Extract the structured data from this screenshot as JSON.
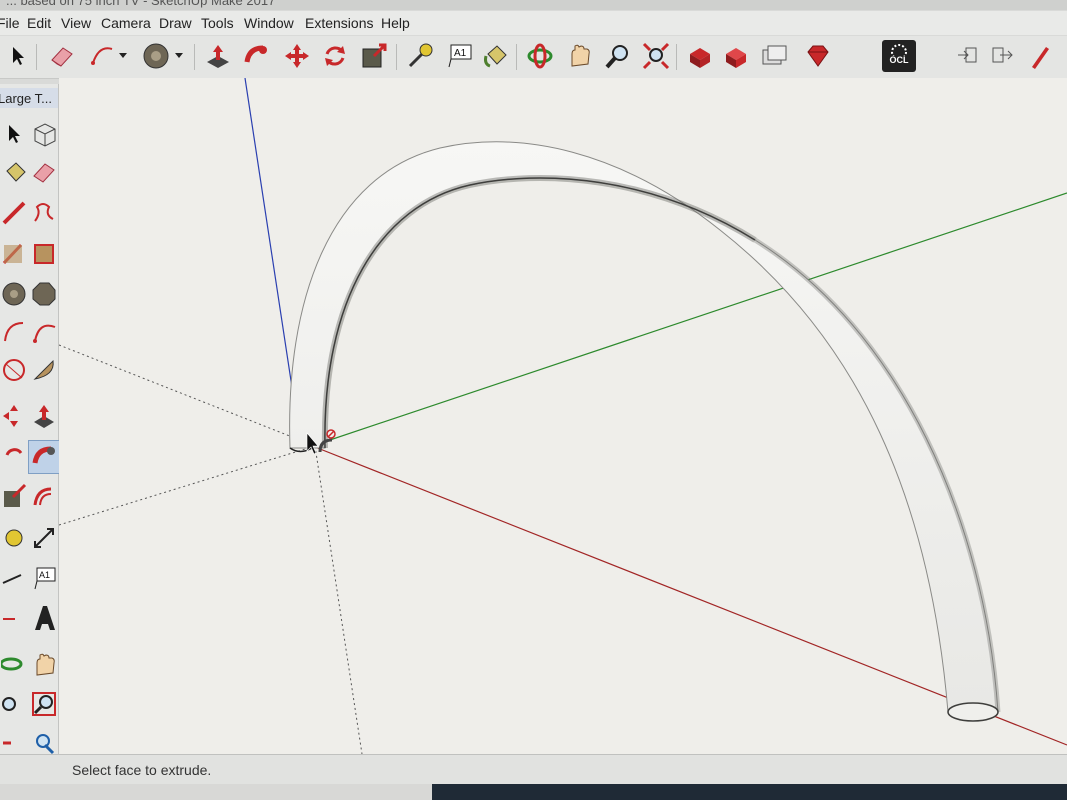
{
  "window": {
    "title": "... based on 75 inch TV - SketchUp Make 2017"
  },
  "menubar": {
    "items": [
      "File",
      "Edit",
      "View",
      "Camera",
      "Draw",
      "Tools",
      "Window",
      "Extensions",
      "Help"
    ]
  },
  "toolbar": {
    "tools": [
      "select-icon",
      "eraser-icon",
      "arc-icon",
      "dropdown-icon",
      "circle-icon",
      "dropdown-icon",
      "push-pull-icon",
      "follow-me-icon",
      "move-icon",
      "rotate-icon",
      "scale-icon",
      "tape-measure-icon",
      "text-icon",
      "paint-bucket-icon",
      "orbit-icon",
      "pan-icon",
      "zoom-icon",
      "zoom-extents-icon",
      "warehouse-icon",
      "extension-warehouse-icon",
      "layout-icon",
      "ruby-icon"
    ],
    "text_tool_label": "A1",
    "ocl_label": "OCL",
    "right_tools": [
      "import-icon",
      "export-icon",
      "pencil-icon"
    ]
  },
  "tray": {
    "title": "Large T...",
    "text_tool_label": "A1"
  },
  "status": {
    "text": "Select face to extrude."
  },
  "colors": {
    "axis_blue": "#2a3fb0",
    "axis_green": "#2d8a2d",
    "axis_red": "#a22626",
    "accent_red": "#c8282a"
  }
}
